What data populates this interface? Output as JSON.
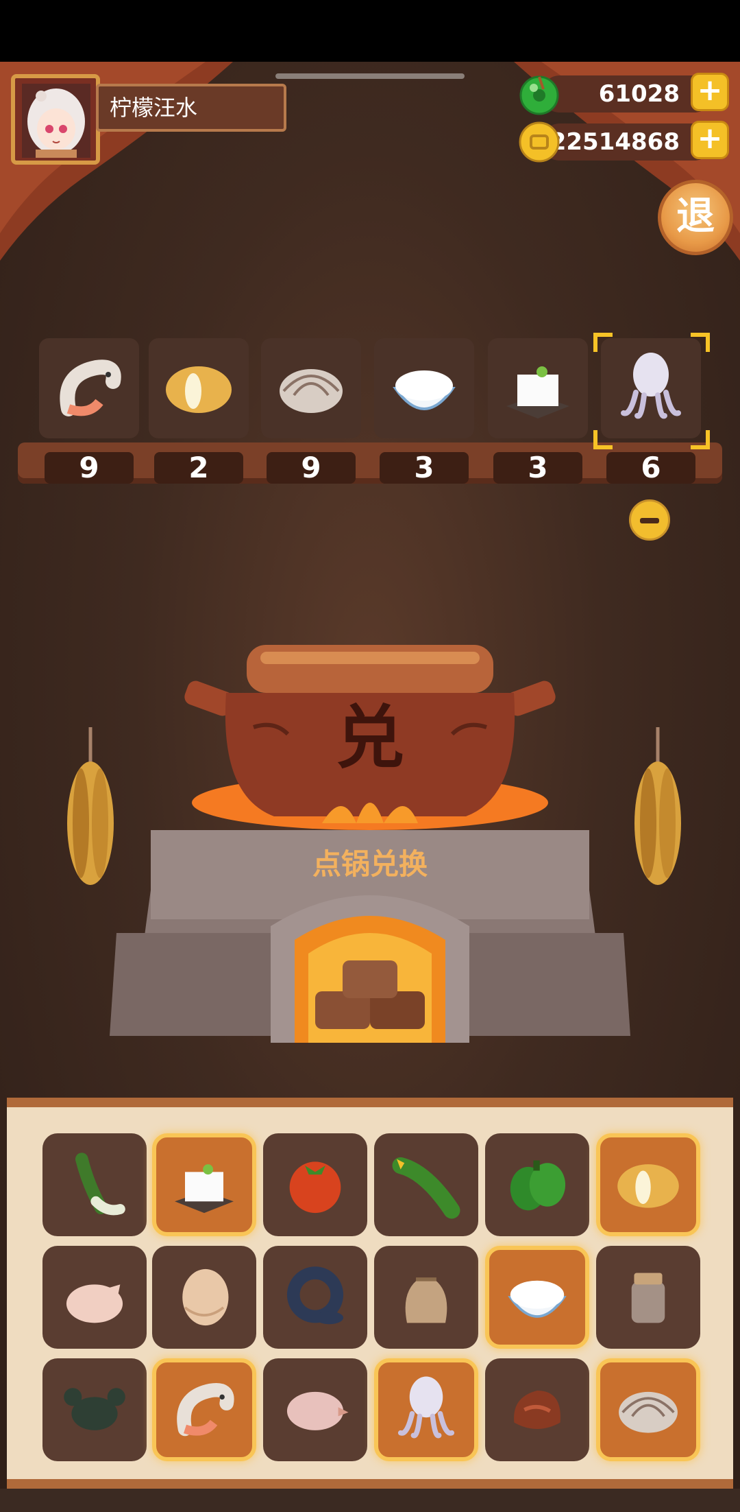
{
  "player": {
    "name": "柠檬汪水"
  },
  "currencies": [
    {
      "icon": "green-gem-icon",
      "value": "61028"
    },
    {
      "icon": "gold-coin-icon",
      "value": "22514868"
    }
  ],
  "exit_button": {
    "label": "退"
  },
  "selected": [
    {
      "icon": "shrimp-icon",
      "count": "9"
    },
    {
      "icon": "potato-icon",
      "count": "2"
    },
    {
      "icon": "clam-icon",
      "count": "9"
    },
    {
      "icon": "rice-bowl-icon",
      "count": "3"
    },
    {
      "icon": "tofu-icon",
      "count": "3"
    },
    {
      "icon": "squid-icon",
      "count": "6"
    }
  ],
  "pot": {
    "glyph": "兑"
  },
  "stove": {
    "label": "点锅兑换"
  },
  "inventory": [
    {
      "icon": "leek-icon",
      "highlighted": false
    },
    {
      "icon": "tofu-icon",
      "highlighted": true
    },
    {
      "icon": "tomato-icon",
      "highlighted": false
    },
    {
      "icon": "cucumber-icon",
      "highlighted": false
    },
    {
      "icon": "green-pepper-icon",
      "highlighted": false
    },
    {
      "icon": "potato-icon",
      "highlighted": true
    },
    {
      "icon": "chicken-icon",
      "highlighted": false
    },
    {
      "icon": "egg-icon",
      "highlighted": false
    },
    {
      "icon": "eel-icon",
      "highlighted": false
    },
    {
      "icon": "flour-sack-icon",
      "highlighted": false
    },
    {
      "icon": "rice-bowl-icon",
      "highlighted": true
    },
    {
      "icon": "jar-icon",
      "highlighted": false
    },
    {
      "icon": "crab-icon",
      "highlighted": false
    },
    {
      "icon": "shrimp-icon",
      "highlighted": true
    },
    {
      "icon": "duck-icon",
      "highlighted": false
    },
    {
      "icon": "squid-icon",
      "highlighted": true
    },
    {
      "icon": "meat-icon",
      "highlighted": false
    },
    {
      "icon": "clam-icon",
      "highlighted": true
    }
  ]
}
